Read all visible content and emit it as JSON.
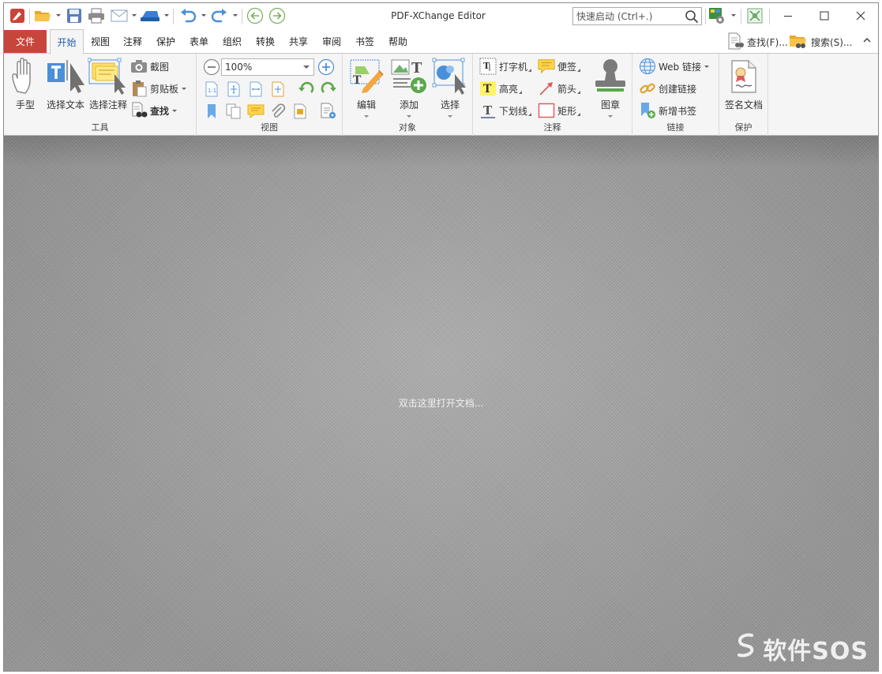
{
  "app": {
    "title": "PDF-XChange Editor",
    "quick_launch_placeholder": "快速启动 (Ctrl+.)"
  },
  "menu": {
    "file_label": "文件",
    "tabs": [
      "开始",
      "视图",
      "注释",
      "保护",
      "表单",
      "组织",
      "转换",
      "共享",
      "审阅",
      "书签",
      "帮助"
    ],
    "active_tab": "开始",
    "find_label": "查找(F)...",
    "search_label": "搜索(S)..."
  },
  "ribbon": {
    "tools": {
      "label": "工具",
      "hand": "手型",
      "select_text": "选择文本",
      "select_annotation": "选择注释",
      "snapshot": "截图",
      "clipboard": "剪贴板",
      "find": "查找"
    },
    "view": {
      "label": "视图",
      "zoom_value": "100%"
    },
    "objects": {
      "label": "对象",
      "edit": "编辑",
      "add": "添加",
      "select": "选择"
    },
    "annotations": {
      "label": "注释",
      "typewriter": "打字机",
      "sticky_note": "便签",
      "highlight": "高亮",
      "arrow": "箭头",
      "underline": "下划线",
      "rectangle": "矩形",
      "stamp": "图章"
    },
    "links": {
      "label": "链接",
      "web_links": "Web 链接",
      "create_link": "创建链接",
      "add_bookmark": "新增书签"
    },
    "protect": {
      "label": "保护",
      "sign_document": "签名文档"
    }
  },
  "document": {
    "open_hint": "双击这里打开文档...",
    "watermark": "软件SOS"
  },
  "colors": {
    "file_tab": "#c8453c",
    "active_tab_text": "#1f5fa8",
    "ribbon_bg": "#f5f5f5",
    "doc_bg": "#a9a9a9"
  }
}
